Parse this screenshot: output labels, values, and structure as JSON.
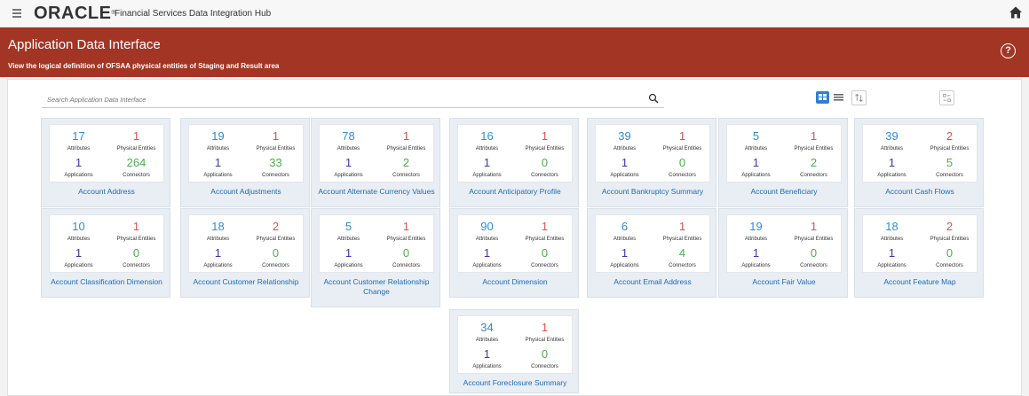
{
  "header": {
    "logo": "ORACLE",
    "product_name": "Financial Services Data Integration Hub"
  },
  "banner": {
    "title": "Application Data Interface",
    "subtitle": "View the logical definition of OFSAA physical entities of Staging and Result area",
    "help": "?"
  },
  "search": {
    "placeholder": "Search Application Data Interface"
  },
  "labels": {
    "attributes": "Attributes",
    "physical_entities": "Physical Entities",
    "applications": "Applications",
    "connectors": "Connectors"
  },
  "cards": [
    {
      "name": "Account Address",
      "attributes": "17",
      "physical_entities": "1",
      "applications": "1",
      "connectors": "264"
    },
    {
      "name": "Account Adjustments",
      "attributes": "19",
      "physical_entities": "1",
      "applications": "1",
      "connectors": "33"
    },
    {
      "name": "Account Alternate Currency Values",
      "attributes": "78",
      "physical_entities": "1",
      "applications": "1",
      "connectors": "2"
    },
    {
      "name": "Account Anticipatory Profile",
      "attributes": "16",
      "physical_entities": "1",
      "applications": "1",
      "connectors": "0"
    },
    {
      "name": "Account Bankruptcy Summary",
      "attributes": "39",
      "physical_entities": "1",
      "applications": "1",
      "connectors": "0"
    },
    {
      "name": "Account Beneficiary",
      "attributes": "5",
      "physical_entities": "1",
      "applications": "1",
      "connectors": "2"
    },
    {
      "name": "Account Cash Flows",
      "attributes": "39",
      "physical_entities": "2",
      "applications": "1",
      "connectors": "5"
    },
    {
      "name": "Account Classification Dimension",
      "attributes": "10",
      "physical_entities": "1",
      "applications": "1",
      "connectors": "0"
    },
    {
      "name": "Account Customer Relationship",
      "attributes": "18",
      "physical_entities": "2",
      "applications": "1",
      "connectors": "0"
    },
    {
      "name": "Account Customer Relationship Change",
      "attributes": "5",
      "physical_entities": "1",
      "applications": "1",
      "connectors": "0"
    },
    {
      "name": "Account Dimension",
      "attributes": "90",
      "physical_entities": "1",
      "applications": "1",
      "connectors": "0"
    },
    {
      "name": "Account Email Address",
      "attributes": "6",
      "physical_entities": "1",
      "applications": "1",
      "connectors": "4"
    },
    {
      "name": "Account Fair Value",
      "attributes": "19",
      "physical_entities": "1",
      "applications": "1",
      "connectors": "0"
    },
    {
      "name": "Account Feature Map",
      "attributes": "18",
      "physical_entities": "2",
      "applications": "1",
      "connectors": "0"
    },
    {
      "name": "Account Foreclosure Summary",
      "attributes": "34",
      "physical_entities": "1",
      "applications": "1",
      "connectors": "0"
    }
  ]
}
